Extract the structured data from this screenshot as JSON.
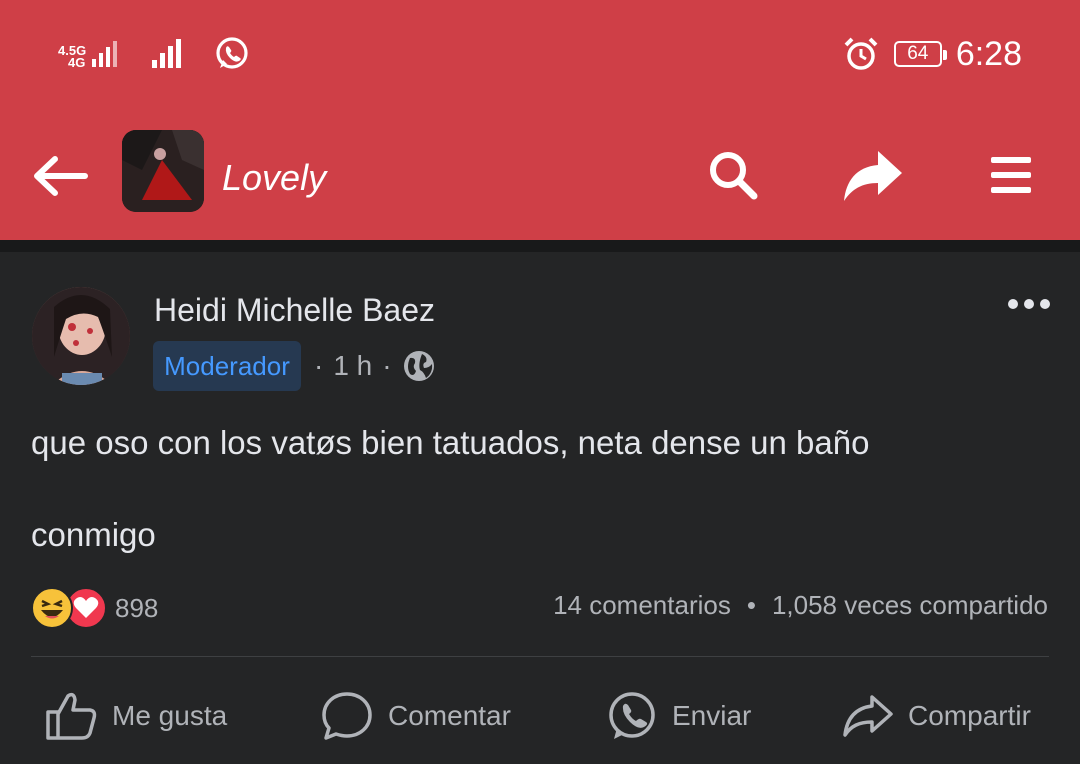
{
  "status_bar": {
    "network_label_top": "4.5G",
    "network_label_bottom": "4G",
    "battery": "64",
    "time": "6:28",
    "icons": [
      "signal-icon",
      "signal-icon",
      "whatsapp-icon",
      "alarm-icon",
      "battery-icon"
    ]
  },
  "toolbar": {
    "group_name": "Lovely",
    "icons": [
      "back-arrow-icon",
      "search-icon",
      "share-icon",
      "menu-icon"
    ]
  },
  "post": {
    "author": "Heidi Michelle Baez",
    "badge": "Moderador",
    "time": "1 h",
    "dot": "·",
    "text_line1": "que oso con los vatøs bien tatuados, neta dense un baño",
    "text_line2": "conmigo",
    "reaction_count": "898",
    "comments": "14 comentarios",
    "stat_sep": "•",
    "shares": "1,058 veces compartido"
  },
  "actions": {
    "like": "Me gusta",
    "comment": "Comentar",
    "send": "Enviar",
    "share": "Compartir"
  },
  "colors": {
    "header": "#cf3f47",
    "background": "#242526",
    "badge_bg": "#263951",
    "badge_text": "#4599ff"
  }
}
